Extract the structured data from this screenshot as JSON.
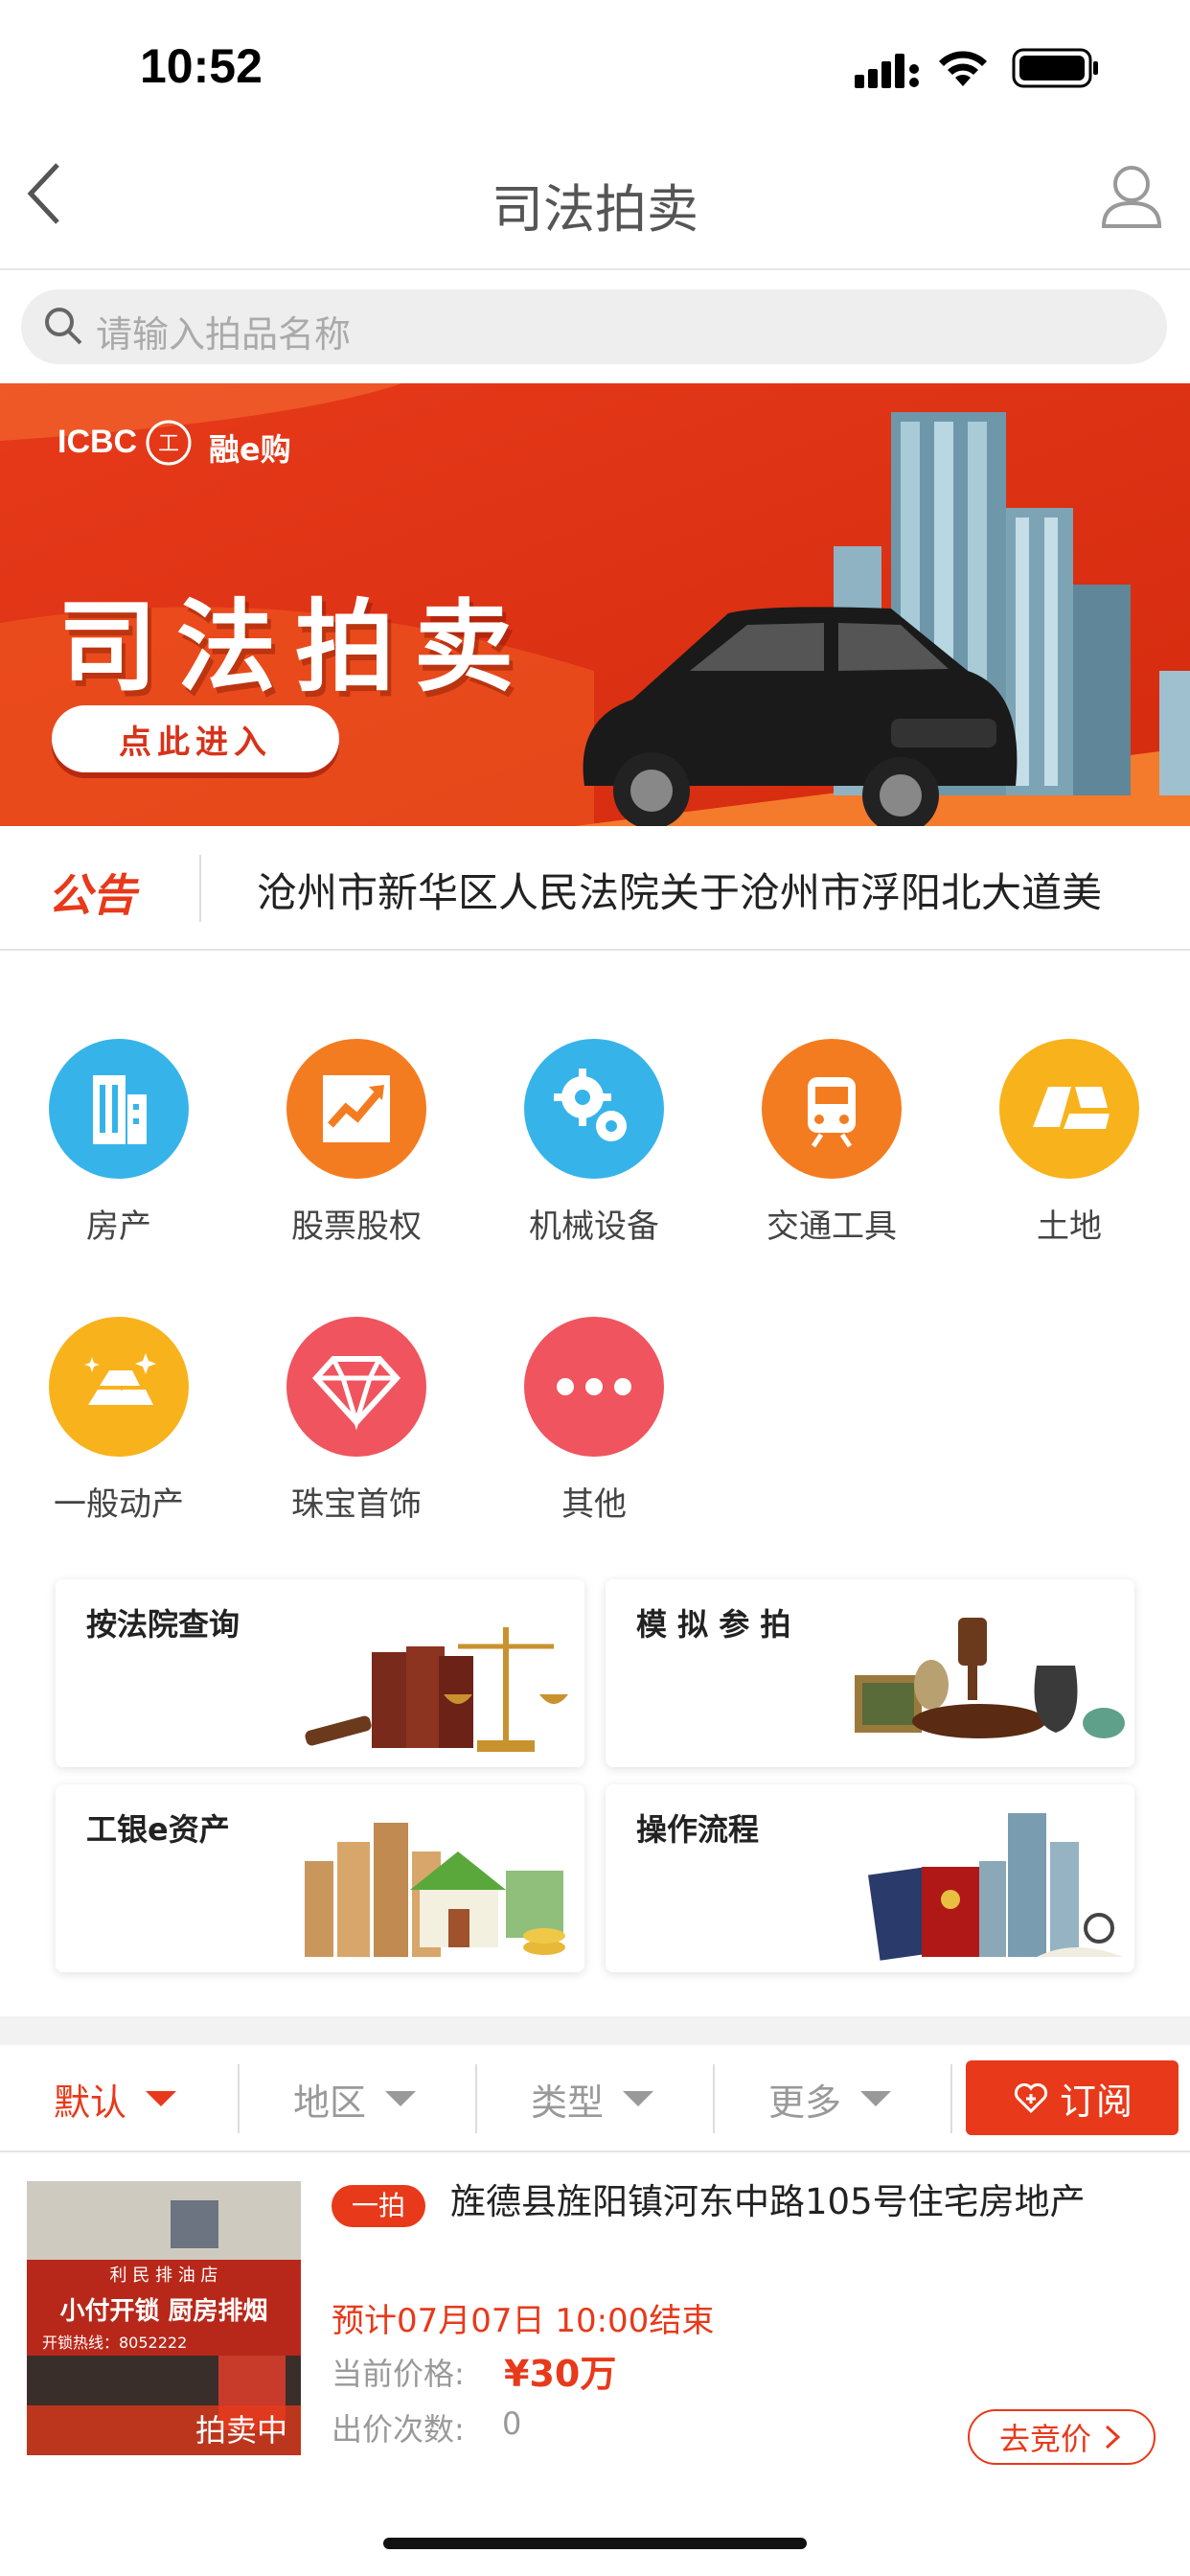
{
  "status_bar": {
    "time": "10:52"
  },
  "nav": {
    "title": "司法拍卖"
  },
  "search": {
    "placeholder": "请输入拍品名称"
  },
  "banner": {
    "brand": "ICBC",
    "brand_sub": "融e购",
    "headline": "司法拍卖",
    "cta": "点此进入"
  },
  "notice": {
    "tag": "公告",
    "text": "沧州市新华区人民法院关于沧州市浮阳北大道美"
  },
  "categories": [
    {
      "label": "房产",
      "icon": "building-icon",
      "color": "#36b4e9"
    },
    {
      "label": "股票股权",
      "icon": "stock-chart-icon",
      "color": "#f47c20"
    },
    {
      "label": "机械设备",
      "icon": "gears-icon",
      "color": "#36b4e9"
    },
    {
      "label": "交通工具",
      "icon": "train-icon",
      "color": "#f47c20"
    },
    {
      "label": "土地",
      "icon": "land-icon",
      "color": "#f8b21c"
    },
    {
      "label": "一般动产",
      "icon": "gold-bars-icon",
      "color": "#f8b21c"
    },
    {
      "label": "珠宝首饰",
      "icon": "diamond-icon",
      "color": "#f0545e"
    },
    {
      "label": "其他",
      "icon": "more-dots-icon",
      "color": "#f0545e"
    }
  ],
  "services": [
    {
      "label": "按法院查询"
    },
    {
      "label": "模 拟 参 拍"
    },
    {
      "label": "工银e资产"
    },
    {
      "label": "操作流程"
    }
  ],
  "filters": [
    {
      "label": "默认",
      "active": true
    },
    {
      "label": "地区"
    },
    {
      "label": "类型"
    },
    {
      "label": "更多"
    }
  ],
  "subscribe": {
    "label": "订阅"
  },
  "listing": {
    "badge": "一拍",
    "title": "旌德县旌阳镇河东中路105号住宅房地产",
    "end_time": "预计07月07日 10:00结束",
    "price_label": "当前价格:",
    "price": "¥30万",
    "bids_label": "出价次数:",
    "bids": "0",
    "status": "拍卖中",
    "bid_button": "去竞价",
    "shop_sign_1": "利 民 排 油 店",
    "shop_sign_2": "小付开锁 厨房排烟",
    "shop_sign_3": "开锁热线：8052222"
  },
  "colors": {
    "accent": "#e8391a",
    "text": "#333333",
    "muted": "#999999"
  }
}
